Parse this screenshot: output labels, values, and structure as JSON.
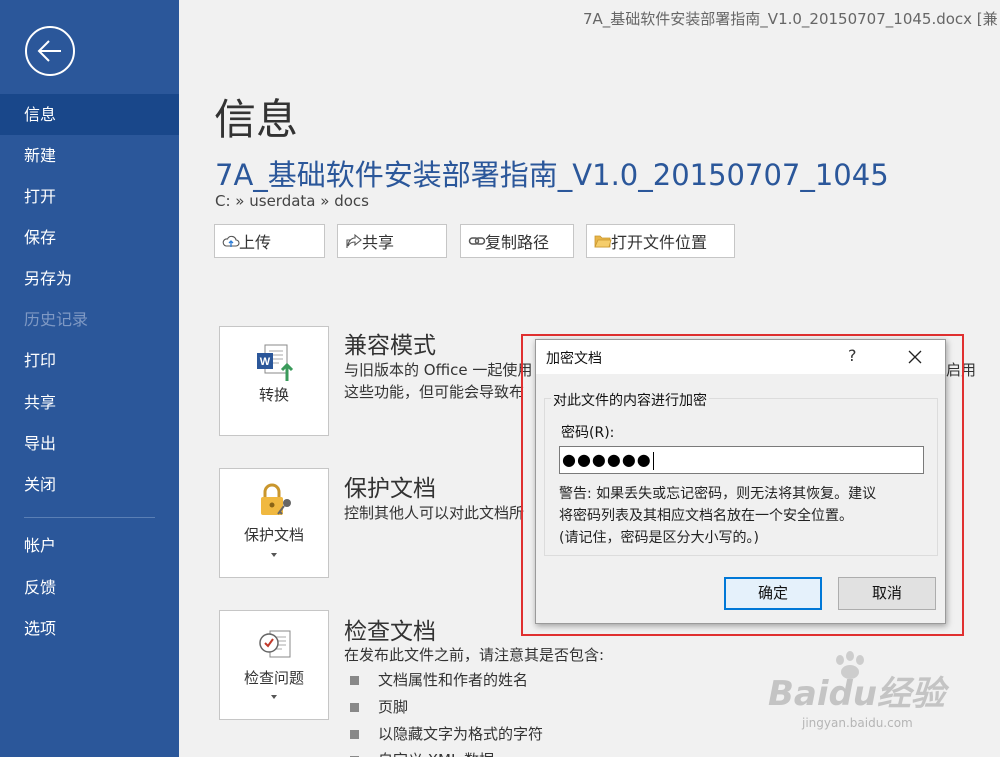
{
  "window_title": "7A_基础软件安装部署指南_V1.0_20150707_1045.docx [兼",
  "sidebar": {
    "items": [
      {
        "label": "信息",
        "active": true,
        "disabled": false
      },
      {
        "label": "新建",
        "active": false,
        "disabled": false
      },
      {
        "label": "打开",
        "active": false,
        "disabled": false
      },
      {
        "label": "保存",
        "active": false,
        "disabled": false
      },
      {
        "label": "另存为",
        "active": false,
        "disabled": false
      },
      {
        "label": "历史记录",
        "active": false,
        "disabled": true
      },
      {
        "label": "打印",
        "active": false,
        "disabled": false
      },
      {
        "label": "共享",
        "active": false,
        "disabled": false
      },
      {
        "label": "导出",
        "active": false,
        "disabled": false
      },
      {
        "label": "关闭",
        "active": false,
        "disabled": false
      },
      {
        "label": "帐户",
        "active": false,
        "disabled": false
      },
      {
        "label": "反馈",
        "active": false,
        "disabled": false
      },
      {
        "label": "选项",
        "active": false,
        "disabled": false
      }
    ]
  },
  "main": {
    "page_title": "信息",
    "doc_name": "7A_基础软件安装部署指南_V1.0_20150707_1045",
    "doc_path": "C: » userdata » docs",
    "actions": {
      "upload": "上传",
      "share": "共享",
      "copy_path": "复制路径",
      "open_location": "打开文件位置"
    },
    "sections": {
      "convert": {
        "card_label": "转换",
        "title": "兼容模式",
        "desc_line1": "与旧版本的 Office 一起使用",
        "desc_line1_tail": "启用",
        "desc_line2": "这些功能，但可能会导致布"
      },
      "protect": {
        "card_label": "保护文档",
        "title": "保护文档",
        "desc": "控制其他人可以对此文档所"
      },
      "inspect": {
        "card_label": "检查问题",
        "title": "检查文档",
        "desc": "在发布此文件之前，请注意其是否包含:",
        "bullets": [
          "文档属性和作者的姓名",
          "页脚",
          "以隐藏文字为格式的字符",
          "自定义 XML 数据"
        ]
      }
    }
  },
  "dialog": {
    "title": "加密文档",
    "help": "?",
    "group_label": "对此文件的内容进行加密",
    "password_label": "密码(R):",
    "password_value": "●●●●●●",
    "warning_line1": "警告: 如果丢失或忘记密码，则无法将其恢复。建议",
    "warning_line2": "将密码列表及其相应文档名放在一个安全位置。",
    "warning_line3": "(请记住，密码是区分大小写的。)",
    "ok_label": "确定",
    "cancel_label": "取消"
  },
  "watermark": {
    "main": "Baidu经验",
    "sub": "jingyan.baidu.com"
  },
  "colors": {
    "sidebar_bg": "#2b579a",
    "accent_blue": "#2b579a",
    "highlight_red": "#e03030",
    "ok_border": "#0078d7"
  }
}
